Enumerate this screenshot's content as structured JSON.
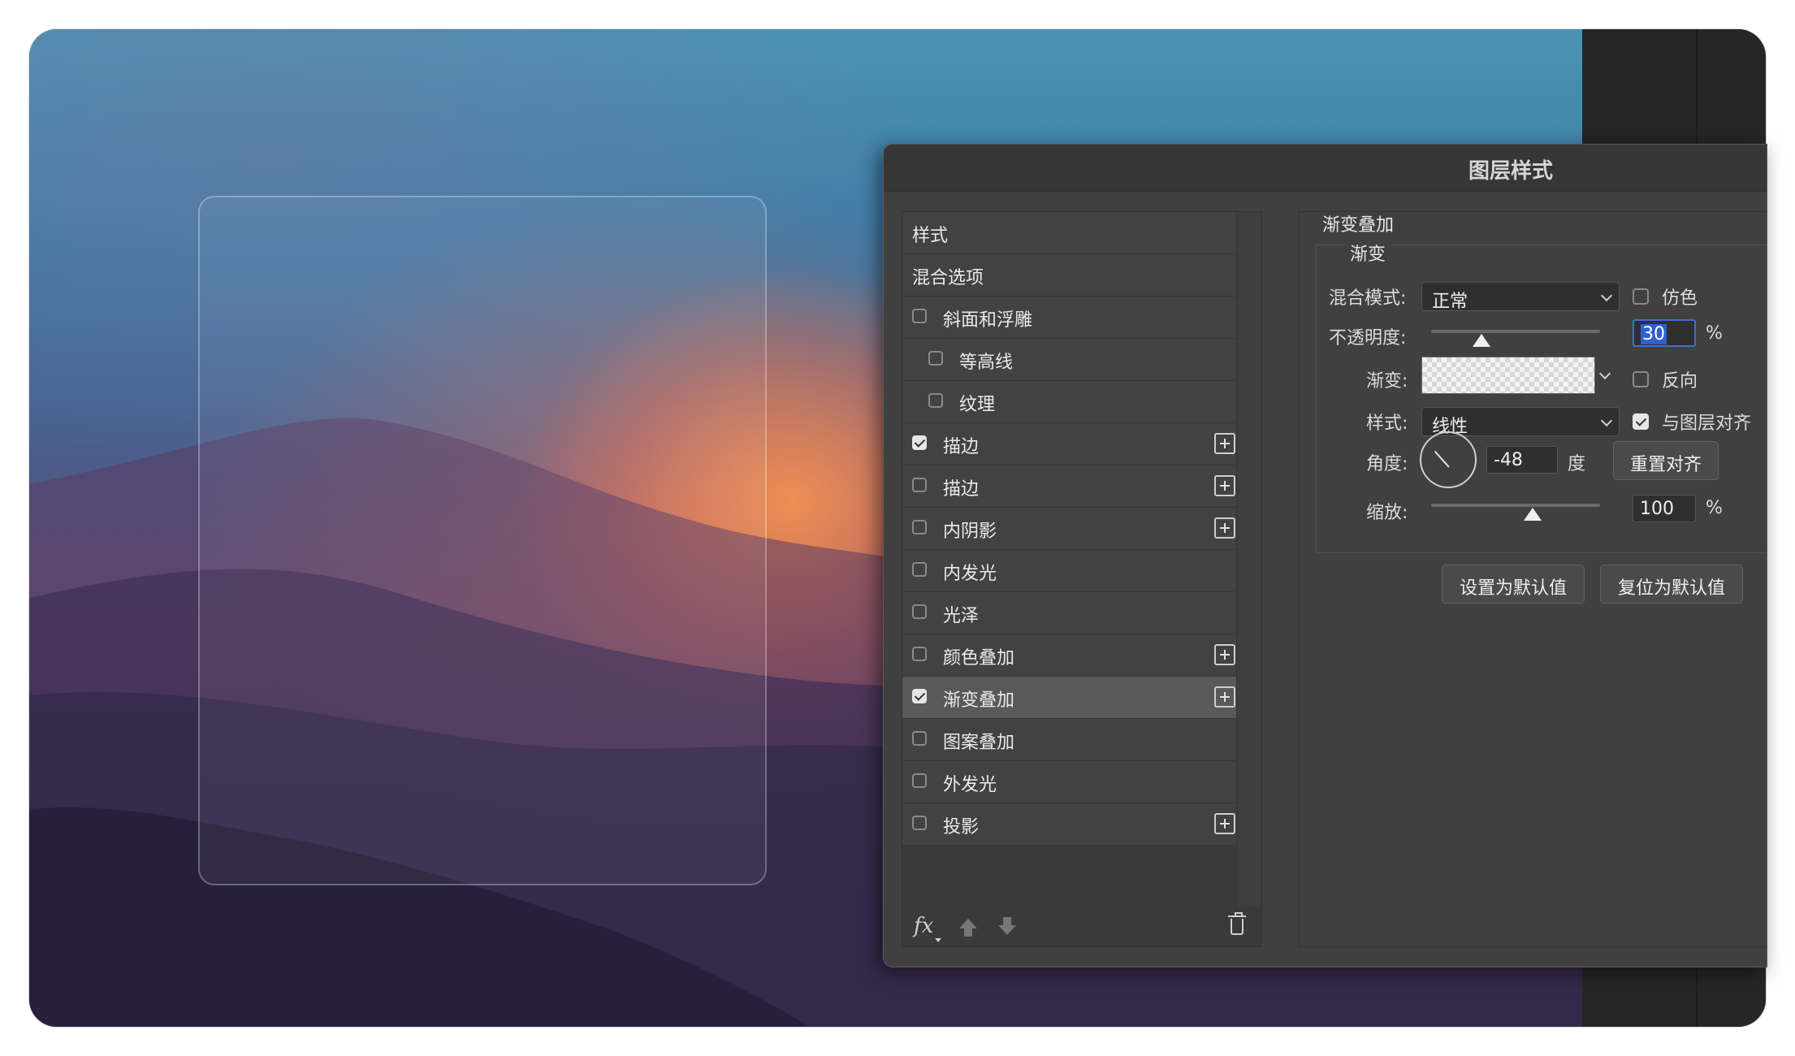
{
  "dialog": {
    "title": "图层样式"
  },
  "styles_list": {
    "items": [
      {
        "label": "样式",
        "checkbox": false,
        "checked": false,
        "plus": false,
        "indent": 0,
        "selected": false
      },
      {
        "label": "混合选项",
        "checkbox": false,
        "checked": false,
        "plus": false,
        "indent": 0,
        "selected": false
      },
      {
        "label": "斜面和浮雕",
        "checkbox": true,
        "checked": false,
        "plus": false,
        "indent": 0,
        "selected": false
      },
      {
        "label": "等高线",
        "checkbox": true,
        "checked": false,
        "plus": false,
        "indent": 1,
        "selected": false
      },
      {
        "label": "纹理",
        "checkbox": true,
        "checked": false,
        "plus": false,
        "indent": 1,
        "selected": false
      },
      {
        "label": "描边",
        "checkbox": true,
        "checked": true,
        "plus": true,
        "indent": 0,
        "selected": false
      },
      {
        "label": "描边",
        "checkbox": true,
        "checked": false,
        "plus": true,
        "indent": 0,
        "selected": false
      },
      {
        "label": "内阴影",
        "checkbox": true,
        "checked": false,
        "plus": true,
        "indent": 0,
        "selected": false
      },
      {
        "label": "内发光",
        "checkbox": true,
        "checked": false,
        "plus": false,
        "indent": 0,
        "selected": false
      },
      {
        "label": "光泽",
        "checkbox": true,
        "checked": false,
        "plus": false,
        "indent": 0,
        "selected": false
      },
      {
        "label": "颜色叠加",
        "checkbox": true,
        "checked": false,
        "plus": true,
        "indent": 0,
        "selected": false
      },
      {
        "label": "渐变叠加",
        "checkbox": true,
        "checked": true,
        "plus": true,
        "indent": 0,
        "selected": true
      },
      {
        "label": "图案叠加",
        "checkbox": true,
        "checked": false,
        "plus": false,
        "indent": 0,
        "selected": false
      },
      {
        "label": "外发光",
        "checkbox": true,
        "checked": false,
        "plus": false,
        "indent": 0,
        "selected": false
      },
      {
        "label": "投影",
        "checkbox": true,
        "checked": false,
        "plus": true,
        "indent": 0,
        "selected": false
      }
    ],
    "footer": {
      "fx_label": "fx"
    }
  },
  "gradient_overlay": {
    "section_title": "渐变叠加",
    "group_title": "渐变",
    "blend_mode_label": "混合模式:",
    "blend_mode_value": "正常",
    "dither_label": "仿色",
    "dither_checked": false,
    "opacity_label": "不透明度:",
    "opacity_value": "30",
    "opacity_unit": "%",
    "opacity_fraction": 0.3,
    "gradient_label": "渐变:",
    "reverse_label": "反向",
    "reverse_checked": false,
    "style_label": "样式:",
    "style_value": "线性",
    "align_label": "与图层对齐",
    "align_checked": true,
    "angle_label": "角度:",
    "angle_value": "-48",
    "angle_unit": "度",
    "reset_align_label": "重置对齐",
    "scale_label": "缩放:",
    "scale_value": "100",
    "scale_unit": "%",
    "scale_fraction": 0.6,
    "set_default_label": "设置为默认值",
    "reset_default_label": "复位为默认值"
  },
  "colors": {
    "dialog_bg": "#404040",
    "selected_row": "#595959",
    "focus_blue": "#3a6fd8"
  }
}
